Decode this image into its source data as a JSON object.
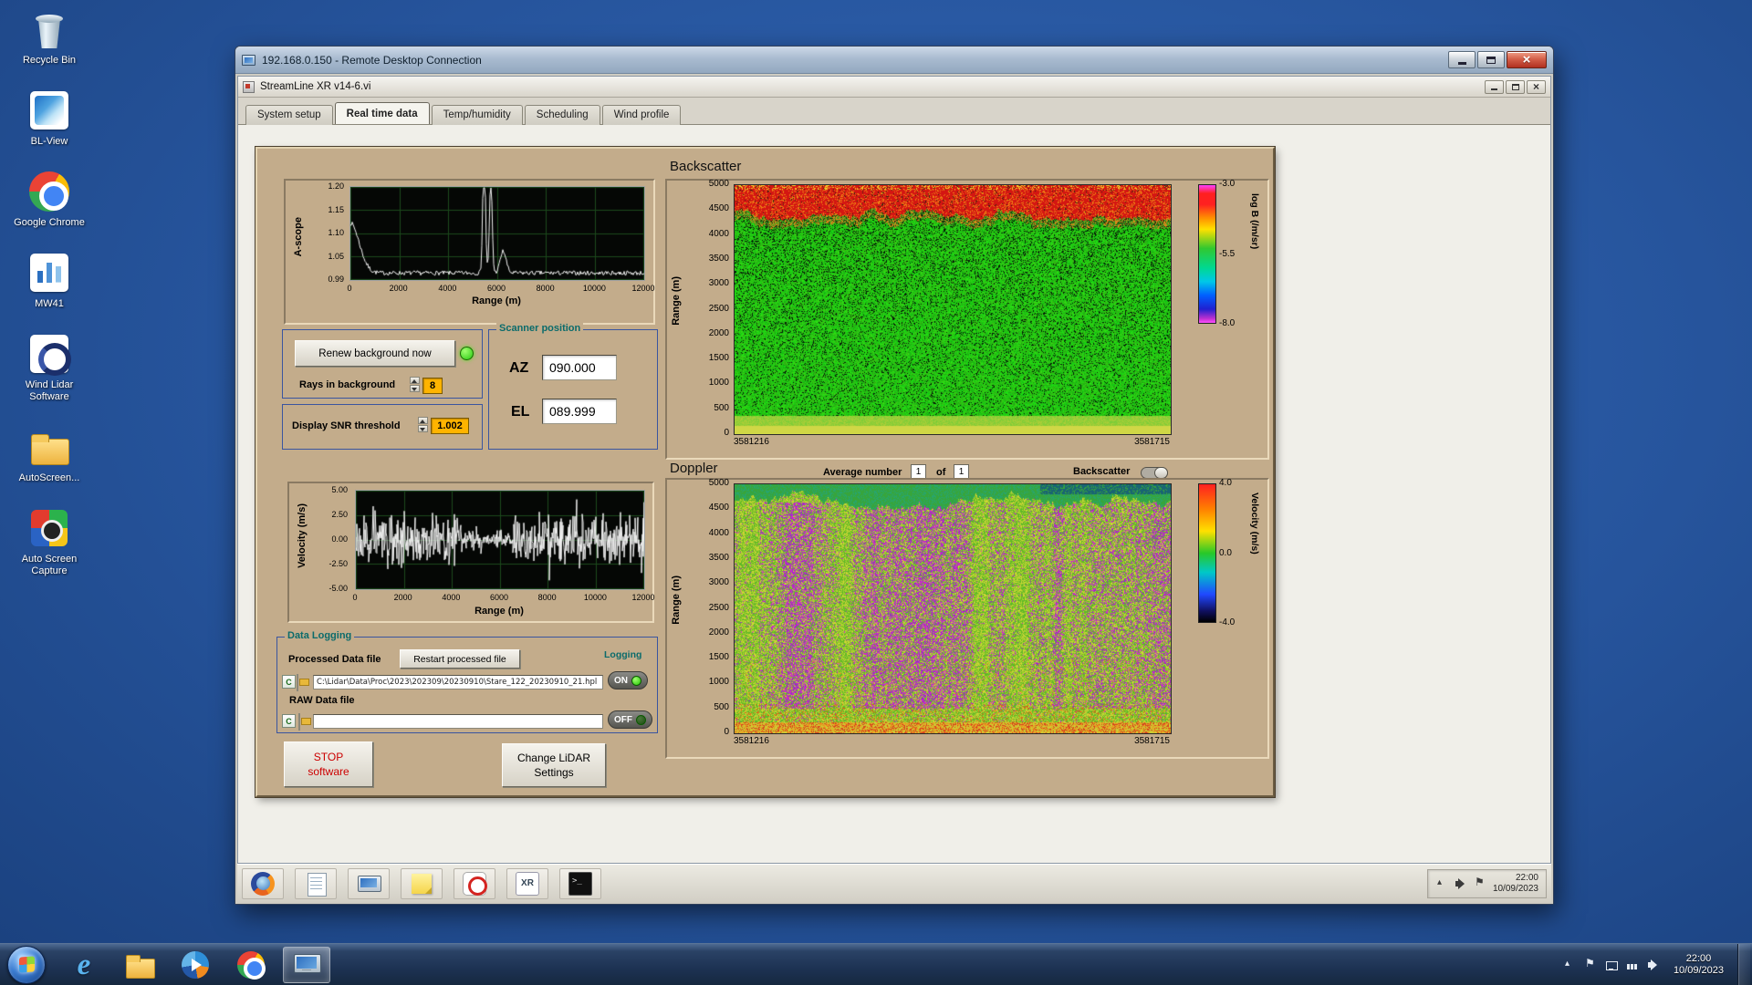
{
  "colors": {
    "panel_tan": "#c3ac8b",
    "amber_field": "#ffb400",
    "teal_label": "#0b6b6b",
    "led_green": "#2bd100",
    "stop_red": "#cc0000"
  },
  "desktop_icons": [
    {
      "id": "recycle-bin",
      "label": "Recycle Bin"
    },
    {
      "id": "bl-view",
      "label": "BL-View"
    },
    {
      "id": "chrome",
      "label": "Google Chrome"
    },
    {
      "id": "mw41",
      "label": "MW41"
    },
    {
      "id": "wind-lidar",
      "label": "Wind Lidar Software"
    },
    {
      "id": "autoscreen",
      "label": "AutoScreen..."
    },
    {
      "id": "auto-capture",
      "label": "Auto Screen Capture"
    }
  ],
  "rdp": {
    "title": "192.168.0.150 - Remote Desktop Connection"
  },
  "app": {
    "title": "StreamLine XR v14-6.vi",
    "tabs": [
      {
        "label": "System setup",
        "active": false
      },
      {
        "label": "Real time data",
        "active": true
      },
      {
        "label": "Temp/humidity",
        "active": false
      },
      {
        "label": "Scheduling",
        "active": false
      },
      {
        "label": "Wind profile",
        "active": false
      }
    ],
    "sections": {
      "backscatter_title": "Backscatter",
      "doppler_title": "Doppler"
    },
    "ascope": {
      "y_label": "A-scope",
      "x_label": "Range (m)",
      "y_ticks": [
        "1.20",
        "1.15",
        "1.10",
        "1.05",
        "0.99"
      ],
      "x_ticks": [
        "0",
        "2000",
        "4000",
        "6000",
        "8000",
        "10000",
        "12000"
      ]
    },
    "velocity": {
      "y_label": "Velocity (m/s)",
      "x_label": "Range (m)",
      "y_ticks": [
        "5.00",
        "2.50",
        "0.00",
        "-2.50",
        "-5.00"
      ],
      "x_ticks": [
        "0",
        "2000",
        "4000",
        "6000",
        "8000",
        "10000",
        "12000"
      ]
    },
    "backscatter": {
      "y_label": "Range (m)",
      "y_ticks": [
        "5000",
        "4500",
        "4000",
        "3500",
        "3000",
        "2500",
        "2000",
        "1500",
        "1000",
        "500",
        "0"
      ],
      "x_start": "3581216",
      "x_end": "3581715",
      "colorbar": {
        "label": "log B (/m/sr)",
        "ticks": [
          "-3.0",
          "-5.5",
          "-8.0"
        ]
      }
    },
    "doppler": {
      "y_label": "Range (m)",
      "y_ticks": [
        "5000",
        "4500",
        "4000",
        "3500",
        "3000",
        "2500",
        "2000",
        "1500",
        "1000",
        "500",
        "0"
      ],
      "x_start": "3581216",
      "x_end": "3581715",
      "colorbar": {
        "label": "Velocity (m/s)",
        "ticks": [
          "4.0",
          "0.0",
          "-4.0"
        ]
      },
      "average_label": "Average number",
      "avg_current": "1",
      "of_label": "of",
      "avg_total": "1",
      "toggle_label": "Backscatter"
    },
    "scanner": {
      "title": "Scanner position",
      "az_label": "AZ",
      "az_value": "090.000",
      "el_label": "EL",
      "el_value": "089.999"
    },
    "background_ctrl": {
      "renew_button": "Renew background now",
      "rays_label": "Rays in background",
      "rays_value": "8",
      "snr_label": "Display SNR threshold",
      "snr_value": "1.002"
    },
    "logging": {
      "title": "Data Logging",
      "processed_label": "Processed Data file",
      "restart_button": "Restart processed file",
      "logging_label": "Logging",
      "drive_letter": "C",
      "processed_path": "C:\\Lidar\\Data\\Proc\\2023\\202309\\20230910\\Stare_122_20230910_21.hpl",
      "on_label": "ON",
      "raw_label": "RAW Data file",
      "raw_path": "",
      "off_label": "OFF"
    },
    "stop_button": "STOP software",
    "settings_button": "Change LiDAR Settings"
  },
  "inner_taskbar": {
    "icons": [
      "browser",
      "notepad",
      "remote-desktop",
      "sticky-notes",
      "power",
      "streamline",
      "terminal"
    ],
    "clock_time": "22:00",
    "clock_date": "10/09/2023"
  },
  "host_taskbar": {
    "icons": [
      {
        "id": "internet-explorer",
        "active": false
      },
      {
        "id": "windows-explorer",
        "active": false
      },
      {
        "id": "media-player",
        "active": false
      },
      {
        "id": "chrome",
        "active": false
      },
      {
        "id": "remote-desktop",
        "active": true
      }
    ],
    "clock_time": "22:00",
    "clock_date": "10/09/2023"
  },
  "chart_data": [
    {
      "type": "line",
      "title": "A-scope",
      "xlabel": "Range (m)",
      "ylabel": "A-scope",
      "xlim": [
        0,
        12000
      ],
      "ylim": [
        0.99,
        1.2
      ],
      "x_ticks": [
        0,
        2000,
        4000,
        6000,
        8000,
        10000,
        12000
      ],
      "description": "Noisy baseline near 1.00 with an initial peak of about 1.12 at 0 m decaying by 1000 m, and two narrow spikes reaching about 1.20 and 1.16 near 5500-6000 m plus a small bump near 6300 m."
    },
    {
      "type": "heatmap",
      "title": "Backscatter",
      "ylabel": "Range (m)",
      "ylim": [
        0,
        5000
      ],
      "x_range": [
        "3581216",
        "3581715"
      ],
      "colorbar": {
        "label": "log B (/m/sr)",
        "ticks": [
          -3.0,
          -5.5,
          -8.0
        ]
      },
      "description": "Mostly green (around -5.5) with dense black speckle noise, a bright yellow-green band below ~400 m, and a ragged red/orange band (around -3) from ~4400 m to 5000 m with yellow patches at the very top."
    },
    {
      "type": "line",
      "title": "Velocity",
      "xlabel": "Range (m)",
      "ylabel": "Velocity (m/s)",
      "xlim": [
        0,
        12000
      ],
      "ylim": [
        -5,
        5
      ],
      "x_ticks": [
        0,
        2000,
        4000,
        6000,
        8000,
        10000,
        12000
      ],
      "description": "Dense noisy white trace oscillating roughly +/-3 m/s about zero, with a quieter low-amplitude section near 4500-6500 m."
    },
    {
      "type": "heatmap",
      "title": "Doppler",
      "ylabel": "Range (m)",
      "ylim": [
        0,
        5000
      ],
      "x_range": [
        "3581216",
        "3581715"
      ],
      "colorbar": {
        "label": "Velocity (m/s)",
        "ticks": [
          4.0,
          0.0,
          -4.0
        ]
      },
      "description": "Yellow-green field with vertical streaks of magenta/purple speckle up to ~4700 m, warm red/orange patches near the surface, and a teal/green cap above ~4700 m with a darker blue-green region at top right."
    }
  ]
}
